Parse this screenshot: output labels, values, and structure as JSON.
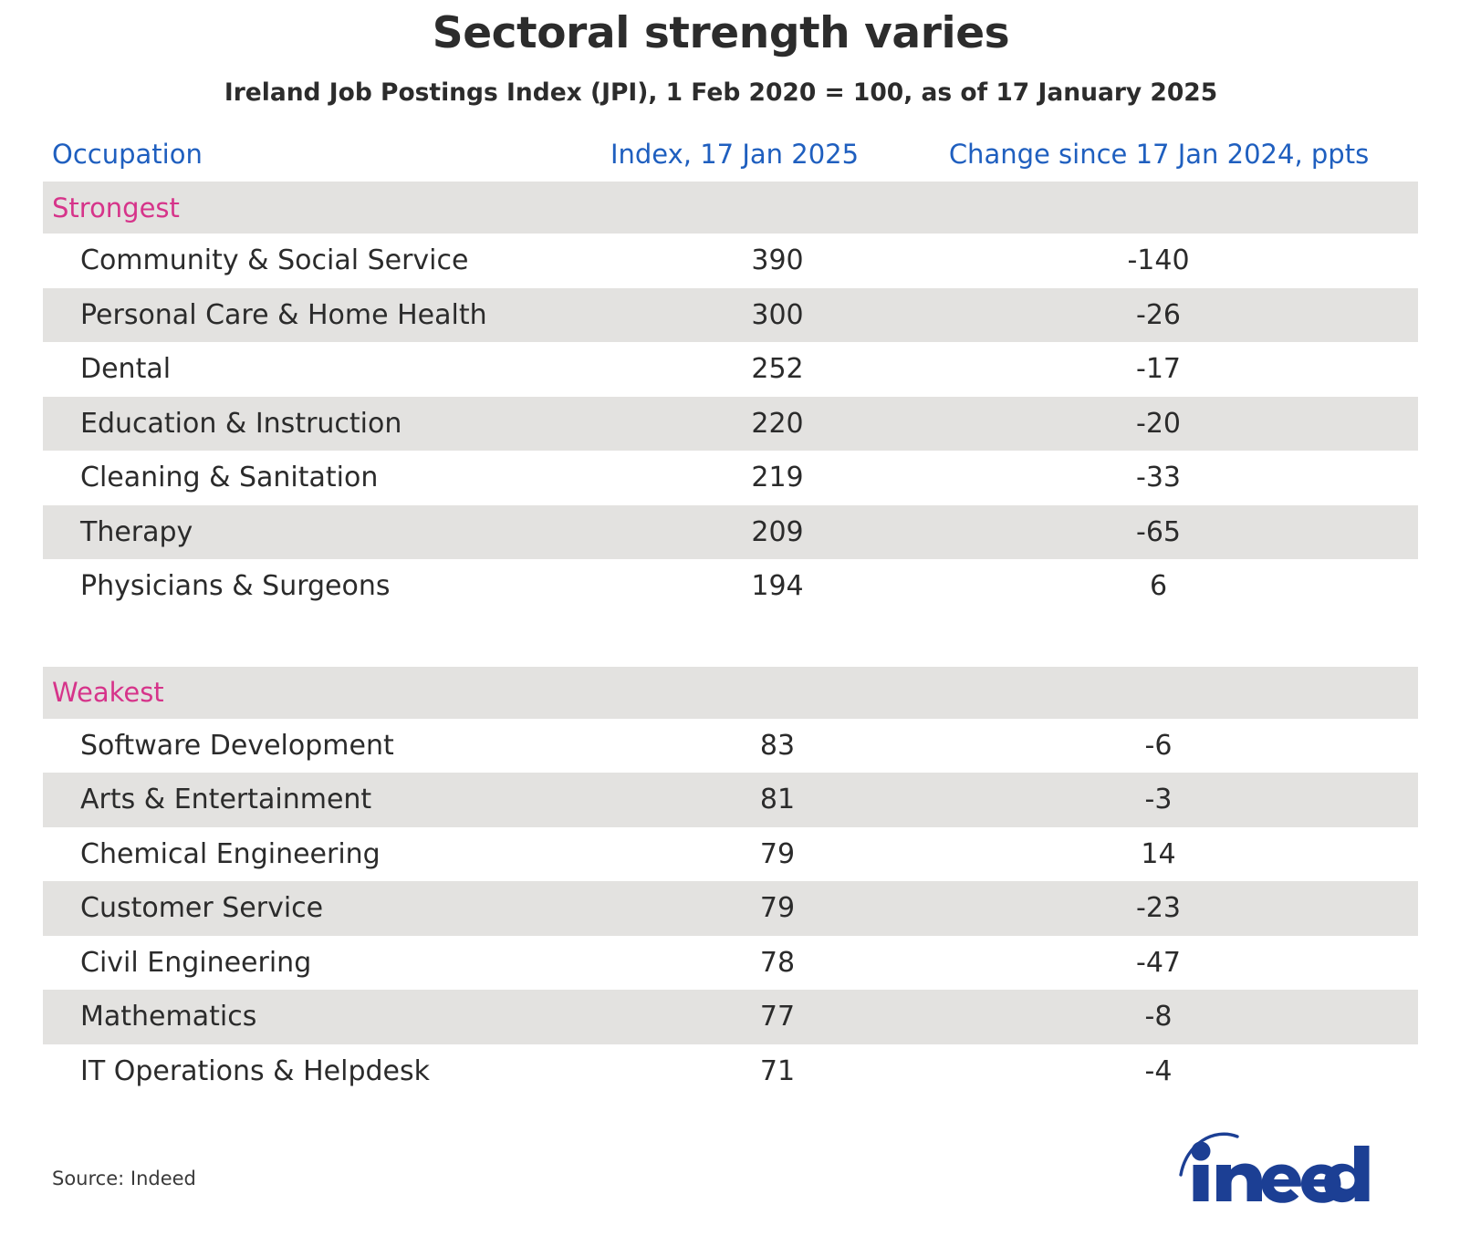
{
  "title": "Sectoral strength varies",
  "subtitle": "Ireland Job Postings Index (JPI), 1 Feb 2020 = 100, as of 17 January 2025",
  "columns": {
    "occupation": "Occupation",
    "index": "Index, 17 Jan 2025",
    "change": "Change since 17 Jan 2024, ppts"
  },
  "groups": {
    "strongest": "Strongest",
    "weakest": "Weakest"
  },
  "footer": {
    "source": "Source: Indeed",
    "logo_text": "indeed"
  },
  "colors": {
    "header_blue": "#1f5fbf",
    "group_pink": "#d6348a",
    "band_gray": "#e3e2e0",
    "text_dark": "#2b2b2b",
    "indeed_blue": "#1c3f94"
  },
  "chart_data": {
    "type": "table",
    "title": "Sectoral strength varies",
    "subtitle": "Ireland Job Postings Index (JPI), 1 Feb 2020 = 100, as of 17 January 2025",
    "columns": [
      "Occupation",
      "Index, 17 Jan 2025",
      "Change since 17 Jan 2024, ppts"
    ],
    "groups": [
      {
        "name": "Strongest",
        "rows": [
          {
            "occupation": "Community & Social Service",
            "index": "390",
            "change": "-140"
          },
          {
            "occupation": "Personal Care & Home Health",
            "index": "300",
            "change": "-26"
          },
          {
            "occupation": "Dental",
            "index": "252",
            "change": "-17"
          },
          {
            "occupation": "Education & Instruction",
            "index": "220",
            "change": "-20"
          },
          {
            "occupation": "Cleaning & Sanitation",
            "index": "219",
            "change": "-33"
          },
          {
            "occupation": "Therapy",
            "index": "209",
            "change": "-65"
          },
          {
            "occupation": "Physicians & Surgeons",
            "index": "194",
            "change": "6"
          }
        ]
      },
      {
        "name": "Weakest",
        "rows": [
          {
            "occupation": "Software Development",
            "index": "83",
            "change": "-6"
          },
          {
            "occupation": "Arts & Entertainment",
            "index": "81",
            "change": "-3"
          },
          {
            "occupation": "Chemical Engineering",
            "index": "79",
            "change": "14"
          },
          {
            "occupation": "Customer Service",
            "index": "79",
            "change": "-23"
          },
          {
            "occupation": "Civil Engineering",
            "index": "78",
            "change": "-47"
          },
          {
            "occupation": "Mathematics",
            "index": "77",
            "change": "-8"
          },
          {
            "occupation": "IT Operations & Helpdesk",
            "index": "71",
            "change": "-4"
          }
        ]
      }
    ],
    "source": "Source: Indeed"
  }
}
